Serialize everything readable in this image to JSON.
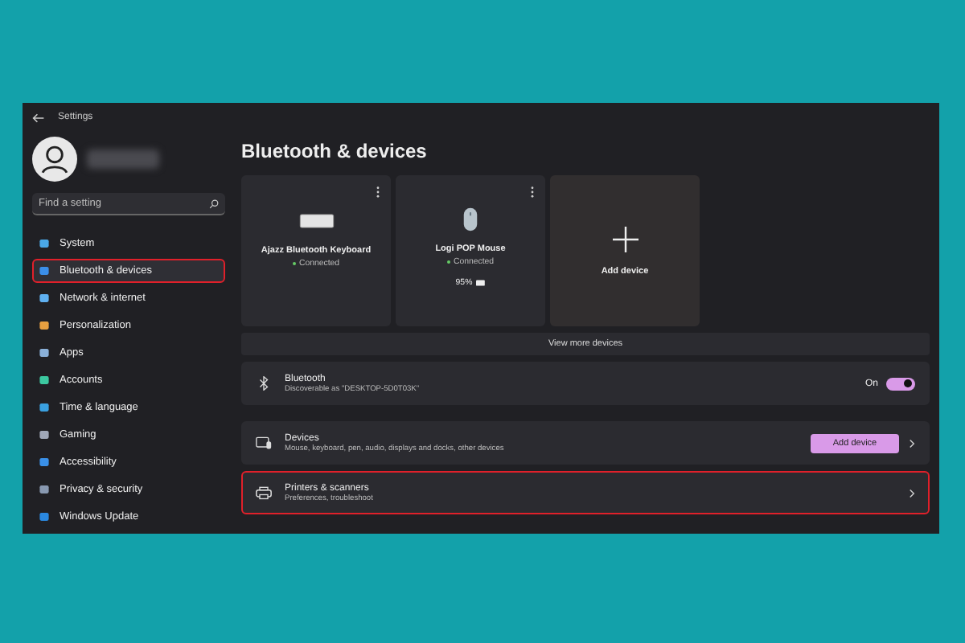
{
  "window": {
    "title": "Settings"
  },
  "search": {
    "placeholder": "Find a setting"
  },
  "sidebar": {
    "items": [
      {
        "label": "System",
        "selected": false,
        "highlighted": false
      },
      {
        "label": "Bluetooth & devices",
        "selected": true,
        "highlighted": true
      },
      {
        "label": "Network & internet",
        "selected": false,
        "highlighted": false
      },
      {
        "label": "Personalization",
        "selected": false,
        "highlighted": false
      },
      {
        "label": "Apps",
        "selected": false,
        "highlighted": false
      },
      {
        "label": "Accounts",
        "selected": false,
        "highlighted": false
      },
      {
        "label": "Time & language",
        "selected": false,
        "highlighted": false
      },
      {
        "label": "Gaming",
        "selected": false,
        "highlighted": false
      },
      {
        "label": "Accessibility",
        "selected": false,
        "highlighted": false
      },
      {
        "label": "Privacy & security",
        "selected": false,
        "highlighted": false
      },
      {
        "label": "Windows Update",
        "selected": false,
        "highlighted": false
      }
    ]
  },
  "page_title": "Bluetooth & devices",
  "devices": [
    {
      "kind": "keyboard",
      "name": "Ajazz Bluetooth Keyboard",
      "status": "Connected"
    },
    {
      "kind": "mouse",
      "name": "Logi POP Mouse",
      "status": "Connected",
      "battery": "95%"
    },
    {
      "kind": "add",
      "name": "Add device"
    }
  ],
  "view_more": "View more devices",
  "bluetooth": {
    "title": "Bluetooth",
    "subtitle": "Discoverable as \"DESKTOP-5D0T03K\"",
    "toggle_label": "On",
    "on": true
  },
  "rows": [
    {
      "kind": "devices",
      "title": "Devices",
      "subtitle": "Mouse, keyboard, pen, audio, displays and docks, other devices",
      "button": "Add device",
      "highlighted": false
    },
    {
      "kind": "printers",
      "title": "Printers & scanners",
      "subtitle": "Preferences, troubleshoot",
      "highlighted": true
    }
  ]
}
